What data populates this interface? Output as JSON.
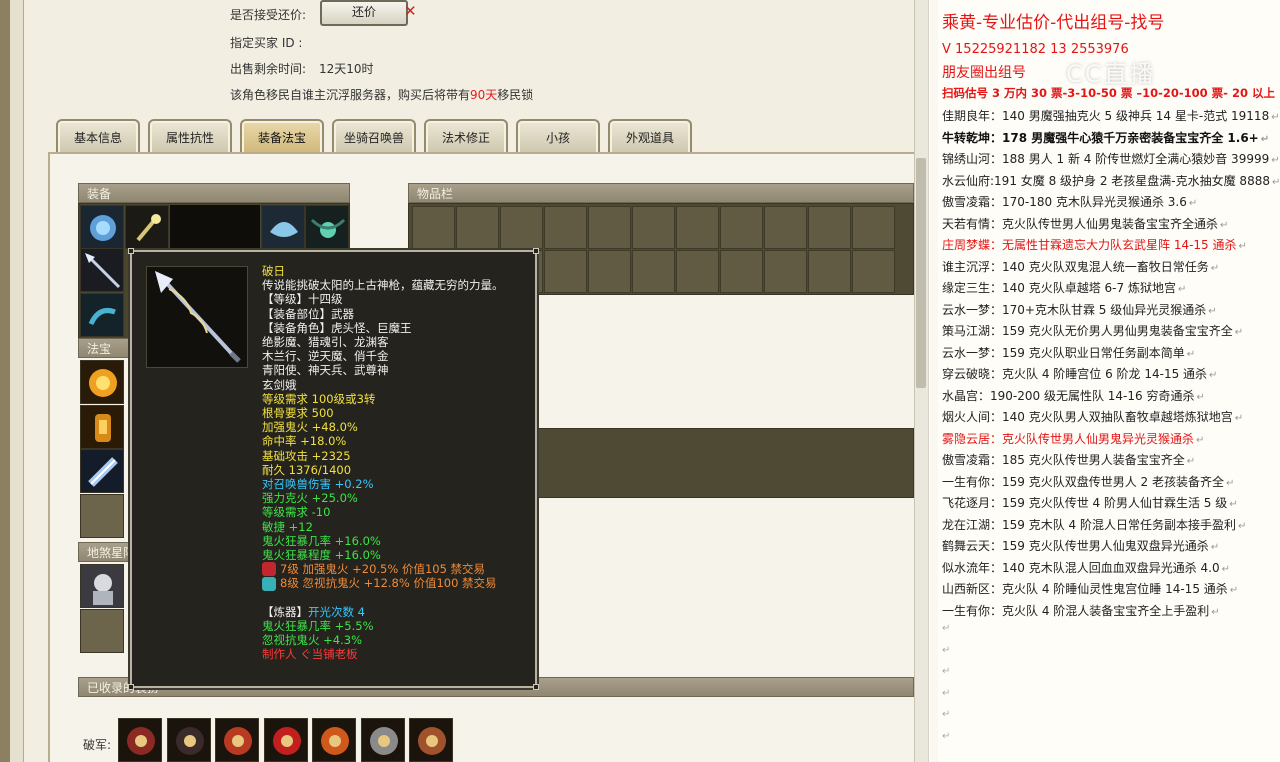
{
  "sale_info": {
    "accept_bargain_label": "是否接受还价:",
    "bargain_button": "还价",
    "buyer_id_label": "指定买家 ID :",
    "remaining_time_label": "出售剩余时间:",
    "remaining_time_value": "12天10时",
    "migration_note_prefix": "该角色移民自谁主沉浮服务器，购买后将带有",
    "migration_days": "90天",
    "migration_note_suffix": "移民锁"
  },
  "tabs": [
    {
      "label": "基本信息",
      "active": false
    },
    {
      "label": "属性抗性",
      "active": false
    },
    {
      "label": "装备法宝",
      "active": true
    },
    {
      "label": "坐骑召唤兽",
      "active": false
    },
    {
      "label": "法术修正",
      "active": false
    },
    {
      "label": "小孩",
      "active": false
    },
    {
      "label": "外观道具",
      "active": false
    }
  ],
  "panels": {
    "equipment": "装备",
    "fabao": "法宝",
    "dishashing": "地煞星阵",
    "inventory": "物品栏",
    "collected": "已收录的装扮",
    "pojun_label": "破军:"
  },
  "tooltip": {
    "item_name": "破日",
    "lines": [
      {
        "text": "传说能挑破太阳的上古神枪，蕴藏无穷的力量。",
        "color": "white"
      },
      {
        "text": "【等级】十四级",
        "color": "white"
      },
      {
        "text": "【装备部位】武器",
        "color": "white"
      },
      {
        "text": "【装备角色】虎头怪、巨魔王",
        "color": "white"
      },
      {
        "text": "绝影魔、猎魂引、龙渊客",
        "color": "white"
      },
      {
        "text": "木兰行、逆天魔、俏千金",
        "color": "white"
      },
      {
        "text": "青阳使、神天兵、武尊神",
        "color": "white"
      },
      {
        "text": "玄剑娥",
        "color": "white"
      },
      {
        "text": "等级需求 100级或3转",
        "color": "yellow"
      },
      {
        "text": "根骨要求 500",
        "color": "yellow"
      },
      {
        "text": "加强鬼火 +48.0%",
        "color": "yellow"
      },
      {
        "text": "命中率 +18.0%",
        "color": "yellow"
      },
      {
        "text": "基础攻击 +2325",
        "color": "yellow"
      },
      {
        "text": "耐久 1376/1400",
        "color": "yellow"
      },
      {
        "text": "对召唤兽伤害 +0.2%",
        "color": "cyan"
      },
      {
        "text": "强力克火 +25.0%",
        "color": "green"
      },
      {
        "text": "等级需求 -10",
        "color": "green"
      },
      {
        "text": "敏捷 +12",
        "color": "green"
      },
      {
        "text": "鬼火狂暴几率 +16.0%",
        "color": "green"
      },
      {
        "text": "鬼火狂暴程度 +16.0%",
        "color": "green"
      }
    ],
    "gems": [
      {
        "text": "7级 加强鬼火 +20.5% 价值105 禁交易",
        "gem_color": "#c2272d"
      },
      {
        "text": "8级 忽视抗鬼火 +12.8% 价值100 禁交易",
        "gem_color": "#39b0b8"
      }
    ],
    "refine_label": "【炼器】",
    "refine_value": "开光次数 4",
    "refine_lines": [
      {
        "text": "鬼火狂暴几率 +5.5%",
        "color": "green"
      },
      {
        "text": "忽视抗鬼火 +4.3%",
        "color": "green"
      }
    ],
    "maker": "制作人 ぐ当铺老板"
  },
  "right_panel": {
    "title": "乘黄-专业估价-代出组号-找号",
    "phone_line": "V    15225921182    13  2553976",
    "pyq": "朋友圈出组号",
    "watermark": "CC直播",
    "price_line": "扫码估号 3 万内 30 票-3-10-50 票 –10-20-100 票- 20 以上 150",
    "entries": [
      {
        "text": "佳期良年：140 男魔强抽克火 5 级神兵 14 星卡-范式 19118",
        "style": "normal"
      },
      {
        "text": "牛转乾坤：178 男魔强牛心猿千万亲密装备宝宝齐全 1.6+",
        "style": "bold"
      },
      {
        "text": "锦绣山河：188 男人 1 新 4 阶传世燃灯全满心猿妙音 39999",
        "style": "normal"
      },
      {
        "text": "水云仙府:191 女魔 8 级护身 2 老孩星盘满-克水抽女魔 8888",
        "style": "normal"
      },
      {
        "text": "傲雪凌霜：170-180 克木队异光灵猴通杀 3.6",
        "style": "normal"
      },
      {
        "text": "天若有情：克火队传世男人仙男鬼装备宝宝齐全通杀",
        "style": "normal"
      },
      {
        "text": "庄周梦蝶：无属性甘霖遗忘大力队玄武星阵 14-15 通杀",
        "style": "red"
      },
      {
        "text": "谁主沉浮：140 克火队双鬼混人统一畜牧日常任务",
        "style": "normal"
      },
      {
        "text": "缘定三生：140 克火队卓越塔 6-7 炼狱地宫",
        "style": "normal"
      },
      {
        "text": "云水一梦：170+克木队甘霖 5 级仙异光灵猴通杀",
        "style": "normal"
      },
      {
        "text": "策马江湖：159 克火队无价男人男仙男鬼装备宝宝齐全",
        "style": "normal"
      },
      {
        "text": "云水一梦：159 克火队职业日常任务副本简单",
        "style": "normal"
      },
      {
        "text": "穿云破晓：克火队 4 阶睡宫位 6 阶龙 14-15 通杀",
        "style": "normal"
      },
      {
        "text": "水晶宫：190-200 级无属性队 14-16 穷奇通杀",
        "style": "normal"
      },
      {
        "text": "烟火人间：140 克火队男人双抽队畜牧卓越塔炼狱地宫",
        "style": "normal"
      },
      {
        "text": "雾隐云居：克火队传世男人仙男鬼异光灵猴通杀",
        "style": "red"
      },
      {
        "text": "傲雪凌霜：185 克火队传世男人装备宝宝齐全",
        "style": "normal"
      },
      {
        "text": "一生有你：159 克火队双盘传世男人 2 老孩装备齐全",
        "style": "normal"
      },
      {
        "text": "飞花逐月：159 克火队传世 4 阶男人仙甘霖生活 5 级",
        "style": "normal"
      },
      {
        "text": "龙在江湖：159 克木队 4 阶混人日常任务副本接手盈利",
        "style": "normal"
      },
      {
        "text": "鹤舞云天：159 克火队传世男人仙鬼双盘异光通杀",
        "style": "normal"
      },
      {
        "text": "似水流年：140 克木队混人回血血双盘异光通杀 4.0",
        "style": "normal"
      },
      {
        "text": "山西新区：克火队 4 阶睡仙灵性鬼宫位睡 14-15 通杀",
        "style": "normal"
      },
      {
        "text": "一生有你：克火队 4 阶混人装备宝宝齐全上手盈利",
        "style": "normal"
      }
    ],
    "return_mark": "↵"
  },
  "colors": {
    "accent_red": "#e31515",
    "panel_head": "#8f8771",
    "tooltip_bg": "#24231d"
  }
}
